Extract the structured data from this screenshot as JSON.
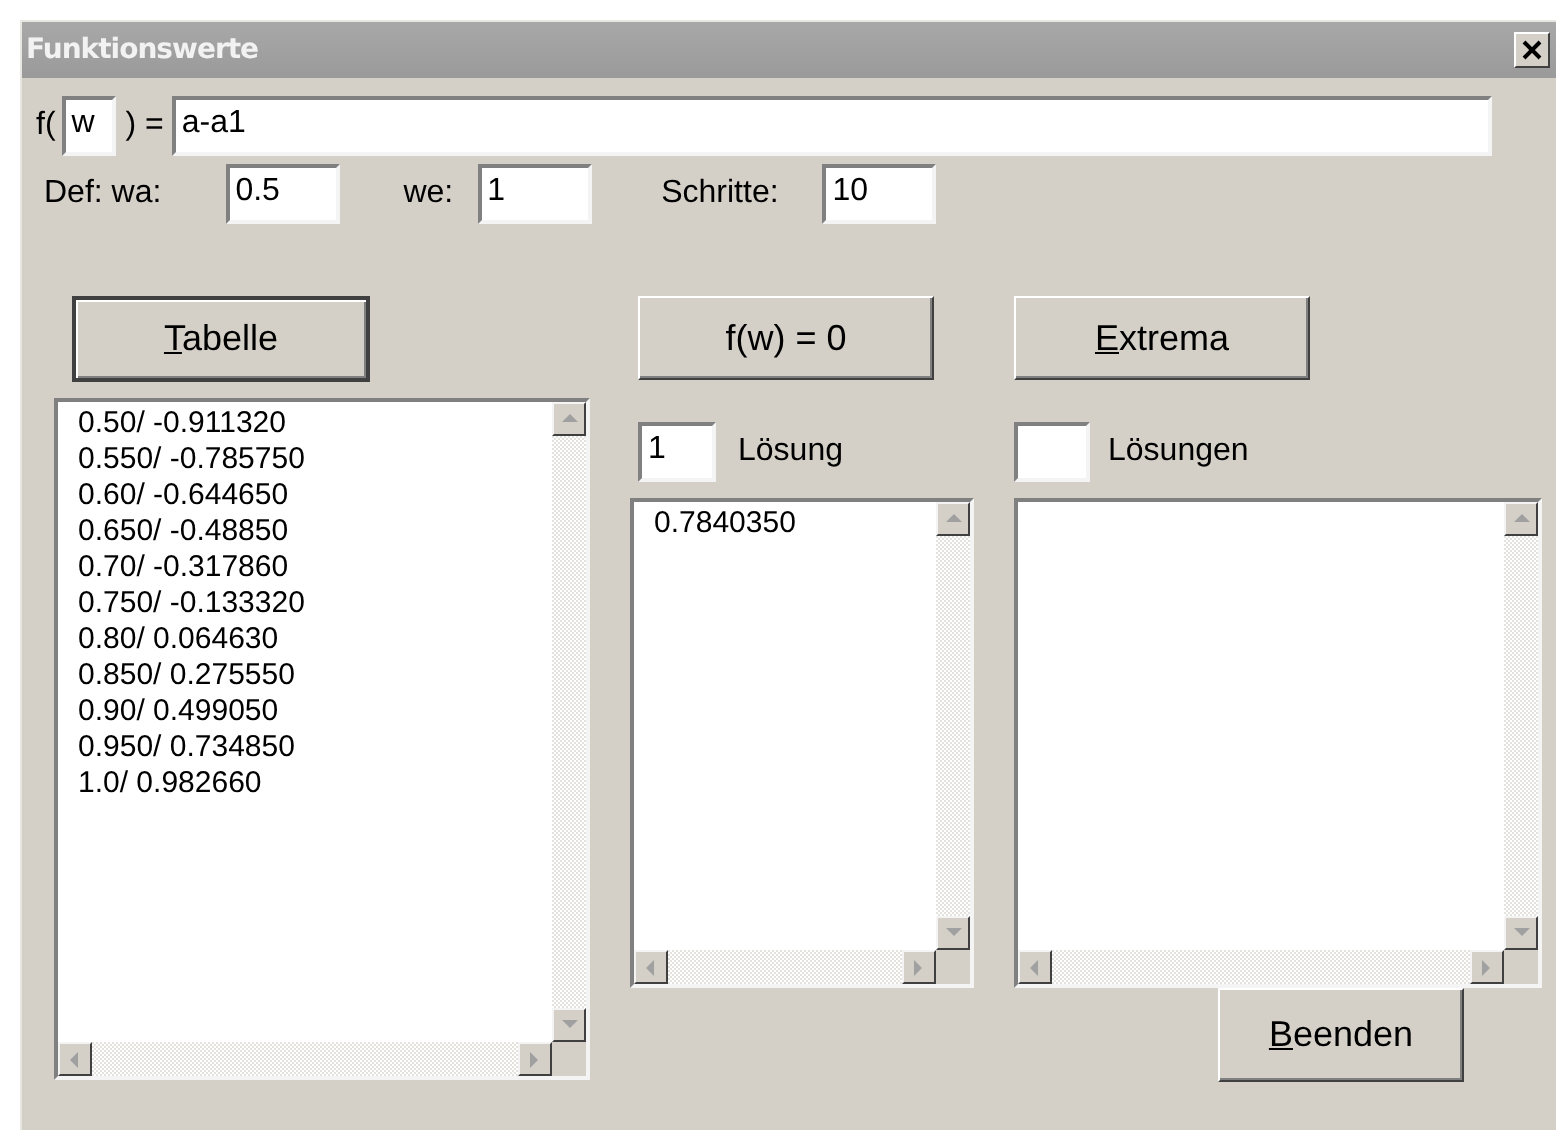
{
  "window": {
    "title": "Funktionswerte"
  },
  "function": {
    "prefix": "f(",
    "variable": "w",
    "suffix": ") =",
    "expression": "a-a1"
  },
  "domain": {
    "start_label": "Def: wa:",
    "start": "0.5",
    "end_label": "we:",
    "end": "1",
    "steps_label": "Schritte:",
    "steps": "10"
  },
  "panels": [
    {
      "kind": "table",
      "button": {
        "label": "Tabelle",
        "default": true,
        "underline_first": true
      },
      "items": [
        "0.50/ -0.911320",
        "0.550/ -0.785750",
        "0.60/ -0.644650",
        "0.650/ -0.48850",
        "0.70/ -0.317860",
        "0.750/ -0.133320",
        "0.80/ 0.064630",
        "0.850/ 0.275550",
        "0.90/ 0.499050",
        "0.950/ 0.734850",
        "1.0/ 0.982660"
      ]
    },
    {
      "kind": "roots",
      "button": {
        "label": "f(w) = 0",
        "default": false,
        "underline_first": false
      },
      "count": "1",
      "count_label": "Lösung",
      "items": [
        "0.7840350"
      ]
    },
    {
      "kind": "extrema",
      "button": {
        "label": "Extrema",
        "default": false,
        "underline_first": true
      },
      "count_label": "Lösungen"
    }
  ],
  "close_button": {
    "label": "Beenden",
    "default": false,
    "underline_first": true
  }
}
